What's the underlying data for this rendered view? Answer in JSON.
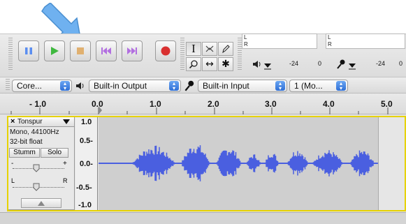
{
  "colors": {
    "accent_blue": "#5b8ef0",
    "wave_blue": "#4a5fe0",
    "track_select_yellow": "#e6d200",
    "record_red": "#d93030",
    "play_green": "#3fb83f",
    "pointer_blue": "#6fb1f0"
  },
  "transport": {
    "pause_icon": "pause-icon",
    "play_icon": "play-icon",
    "stop_icon": "stop-icon",
    "skip_start_icon": "skip-to-start-icon",
    "skip_end_icon": "skip-to-end-icon",
    "record_icon": "record-icon"
  },
  "tools": {
    "selection": "I",
    "envelope": "envelope-icon",
    "draw": "pencil-icon",
    "zoom": "zoom-icon",
    "timeshift": "↔",
    "multi": "✱"
  },
  "meters": {
    "play": {
      "l": "L",
      "r": "R",
      "scale": [
        "-24",
        "0"
      ]
    },
    "record": {
      "l": "L",
      "r": "R",
      "scale": [
        "-24",
        "0"
      ]
    }
  },
  "devices": {
    "host": "Core...",
    "output": "Built-in Output",
    "input": "Built-in Input",
    "channels": "1 (Mo..."
  },
  "ruler": {
    "labels": [
      "- 1.0",
      "0.0",
      "1.0",
      "2.0",
      "3.0",
      "4.0",
      "5.0"
    ]
  },
  "track": {
    "name": "Tonspur",
    "close": "×",
    "info1": "Mono, 44100Hz",
    "info2": "32-bit float",
    "mute_label": "Stumm",
    "solo_label": "Solo",
    "gain_minus": "-",
    "gain_plus": "+",
    "pan_left": "L",
    "pan_right": "R",
    "collapse_icon": "collapse-arrow-icon",
    "scale": [
      "1.0",
      "0.5-",
      "0.0-",
      "-0.5-",
      "-1.0"
    ]
  }
}
